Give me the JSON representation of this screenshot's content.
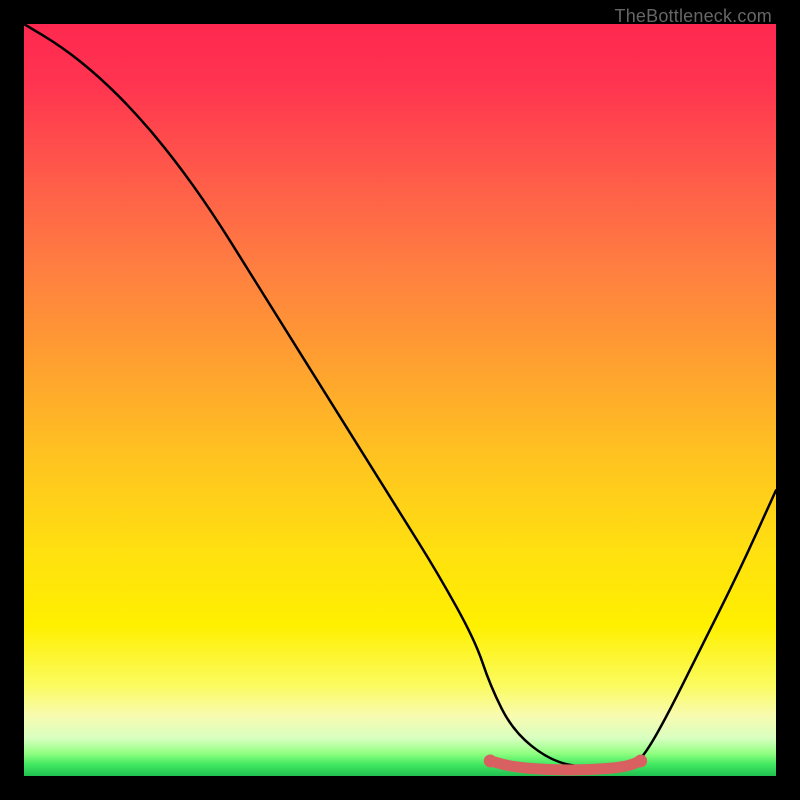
{
  "branding": {
    "watermark": "TheBottleneck.com"
  },
  "chart_data": {
    "type": "line",
    "title": "",
    "xlabel": "",
    "ylabel": "",
    "x_range": [
      0,
      100
    ],
    "y_range": [
      0,
      100
    ],
    "gradient_meaning": "vertical color gradient from red (top, high bottleneck) through yellow to green (bottom, low bottleneck)",
    "series": [
      {
        "name": "bottleneck-curve",
        "color": "#000000",
        "x": [
          0,
          5,
          10,
          15,
          20,
          25,
          30,
          35,
          40,
          45,
          50,
          55,
          60,
          62,
          65,
          70,
          75,
          80,
          82,
          85,
          90,
          95,
          100
        ],
        "values": [
          100,
          97,
          93,
          88,
          82,
          75,
          67,
          59,
          51,
          43,
          35,
          27,
          18,
          12,
          6,
          2,
          1,
          1,
          2,
          7,
          17,
          27,
          38
        ]
      },
      {
        "name": "optimal-range-highlight",
        "color": "#d86060",
        "style": "thick",
        "x": [
          62,
          65,
          70,
          75,
          80,
          82
        ],
        "values": [
          2,
          1.2,
          0.8,
          0.8,
          1.2,
          2
        ]
      }
    ],
    "optimal_range": {
      "x_start": 62,
      "x_end": 82
    }
  }
}
